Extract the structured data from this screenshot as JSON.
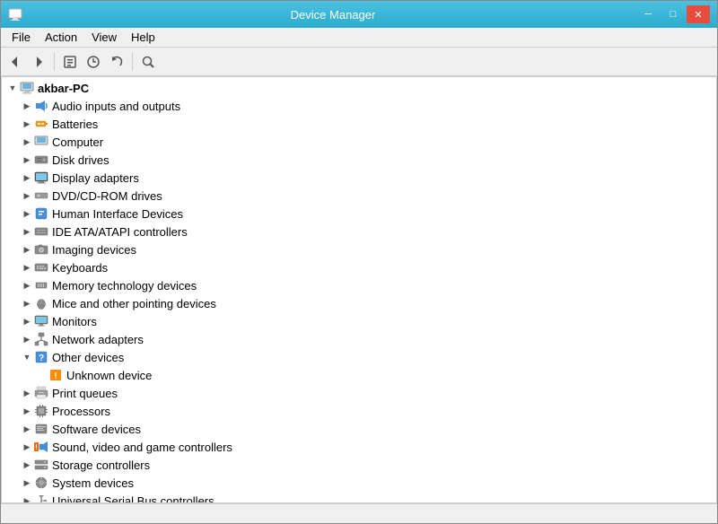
{
  "window": {
    "title": "Device Manager",
    "icon": "💻"
  },
  "titlebar_buttons": {
    "minimize": "─",
    "maximize": "□",
    "close": "✕"
  },
  "menu": {
    "items": [
      {
        "label": "File"
      },
      {
        "label": "Action"
      },
      {
        "label": "View"
      },
      {
        "label": "Help"
      }
    ]
  },
  "toolbar": {
    "buttons": [
      {
        "name": "back-button",
        "icon": "◀"
      },
      {
        "name": "forward-button",
        "icon": "▶"
      },
      {
        "name": "properties-button",
        "icon": "📋"
      },
      {
        "name": "update-button",
        "icon": "🔄"
      },
      {
        "name": "rollback-button",
        "icon": "↩"
      },
      {
        "name": "scan-button",
        "icon": "🔍"
      }
    ]
  },
  "tree": {
    "root": {
      "label": "akbar-PC",
      "expanded": true,
      "children": [
        {
          "label": "Audio inputs and outputs",
          "icon": "audio",
          "expanded": false
        },
        {
          "label": "Batteries",
          "icon": "battery",
          "expanded": false
        },
        {
          "label": "Computer",
          "icon": "computer",
          "expanded": false
        },
        {
          "label": "Disk drives",
          "icon": "disk",
          "expanded": false
        },
        {
          "label": "Display adapters",
          "icon": "display",
          "expanded": false
        },
        {
          "label": "DVD/CD-ROM drives",
          "icon": "dvd",
          "expanded": false
        },
        {
          "label": "Human Interface Devices",
          "icon": "hid",
          "expanded": false
        },
        {
          "label": "IDE ATA/ATAPI controllers",
          "icon": "ide",
          "expanded": false
        },
        {
          "label": "Imaging devices",
          "icon": "imaging",
          "expanded": false
        },
        {
          "label": "Keyboards",
          "icon": "keyboard",
          "expanded": false
        },
        {
          "label": "Memory technology devices",
          "icon": "memory",
          "expanded": false
        },
        {
          "label": "Mice and other pointing devices",
          "icon": "mouse",
          "expanded": false
        },
        {
          "label": "Monitors",
          "icon": "monitor",
          "expanded": false
        },
        {
          "label": "Network adapters",
          "icon": "network",
          "expanded": false
        },
        {
          "label": "Other devices",
          "icon": "other",
          "expanded": true,
          "children": [
            {
              "label": "Unknown device",
              "icon": "unknown",
              "expanded": false
            }
          ]
        },
        {
          "label": "Print queues",
          "icon": "print",
          "expanded": false
        },
        {
          "label": "Processors",
          "icon": "processor",
          "expanded": false
        },
        {
          "label": "Software devices",
          "icon": "software",
          "expanded": false
        },
        {
          "label": "Sound, video and game controllers",
          "icon": "sound_warning",
          "expanded": false,
          "has_warning": true
        },
        {
          "label": "Storage controllers",
          "icon": "storage",
          "expanded": false
        },
        {
          "label": "System devices",
          "icon": "system",
          "expanded": false
        },
        {
          "label": "Universal Serial Bus controllers",
          "icon": "usb",
          "expanded": false
        }
      ]
    }
  },
  "statusbar": {
    "text": ""
  }
}
